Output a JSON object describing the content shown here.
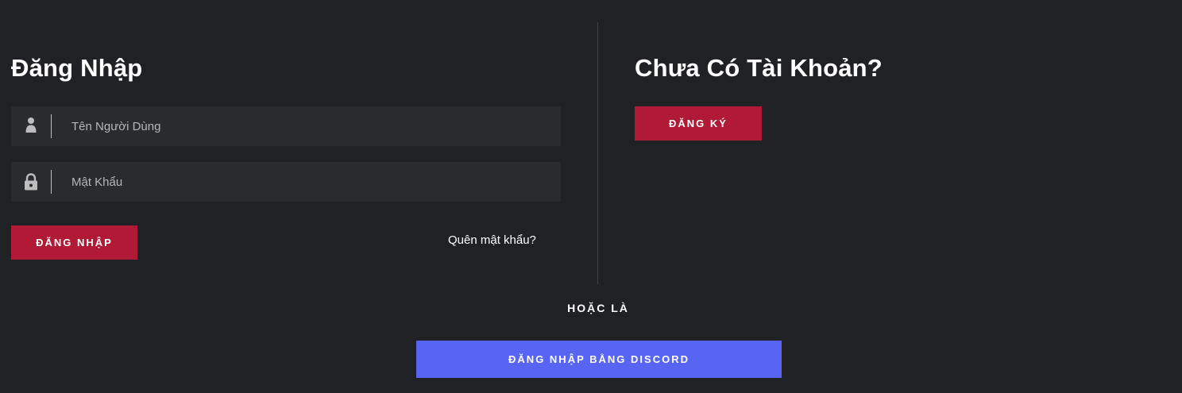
{
  "login": {
    "heading": "Đăng Nhập",
    "username": {
      "placeholder": "Tên Người Dùng",
      "value": "",
      "icon": "user-icon"
    },
    "password": {
      "placeholder": "Mật Khẩu",
      "value": "",
      "icon": "lock-icon"
    },
    "submit_label": "ĐĂNG NHẬP",
    "forgot_label": "Quên mật khẩu?"
  },
  "register": {
    "heading": "Chưa Có Tài Khoản?",
    "button_label": "ĐĂNG KÝ"
  },
  "or_label": "HOẶC LÀ",
  "discord": {
    "button_label": "ĐĂNG NHẬP BẰNG DISCORD"
  },
  "colors": {
    "background": "#202124",
    "field_background": "#2a2b2e",
    "primary_button": "#b01a36",
    "discord_button": "#5865f2",
    "text": "#ffffff",
    "placeholder": "#b7b7b7",
    "icon": "#bdbdbd"
  }
}
